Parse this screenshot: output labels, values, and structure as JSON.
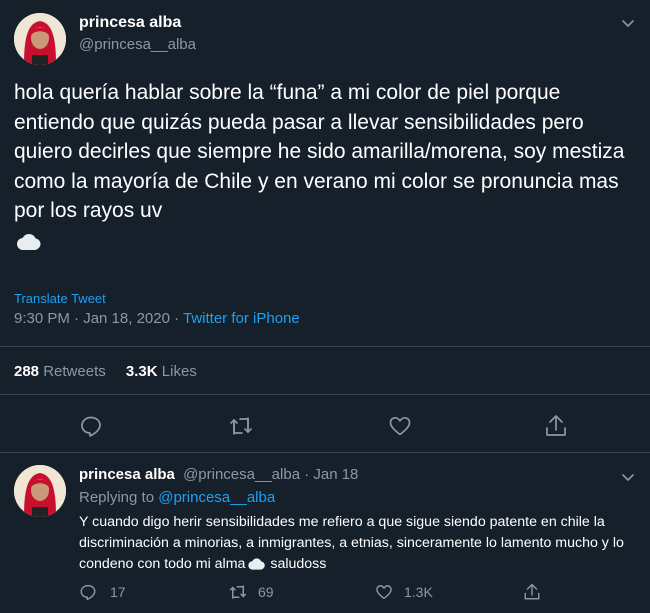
{
  "main_tweet": {
    "display_name": "princesa alba",
    "handle": "@princesa__alba",
    "text": "hola quería hablar sobre la “funa” a mi color de piel porque entiendo que quizás pueda pasar a llevar sensibilidades pero quiero decirles que siempre he sido amarilla/morena, soy mestiza como la mayoría de Chile y en verano mi color se pronuncia mas por los rayos uv",
    "emoji": "cloud-emoji",
    "translate_label": "Translate Tweet",
    "time": "9:30 PM · Jan 18, 2020 · ",
    "source": "Twitter for iPhone",
    "retweets_count": "288",
    "retweets_label": "Retweets",
    "likes_count": "3.3K",
    "likes_label": "Likes"
  },
  "reply_tweet": {
    "display_name": "princesa alba",
    "handle_date": "@princesa__alba · Jan 18",
    "replying_prefix": "Replying to ",
    "replying_handle": "@princesa__alba",
    "text": "Y cuando digo herir sensibilidades me refiero a que sigue siendo patente en chile la discriminación a minorias, a inmigrantes, a etnias, sinceramente lo lamento mucho y lo condeno con todo mi alma",
    "text_end": " saludoss",
    "reply_count": "17",
    "retweet_count": "69",
    "like_count": "1.3K"
  },
  "colors": {
    "background": "#15202b",
    "muted": "#8899a6",
    "accent": "#1da1f2",
    "divider": "#38444d"
  }
}
